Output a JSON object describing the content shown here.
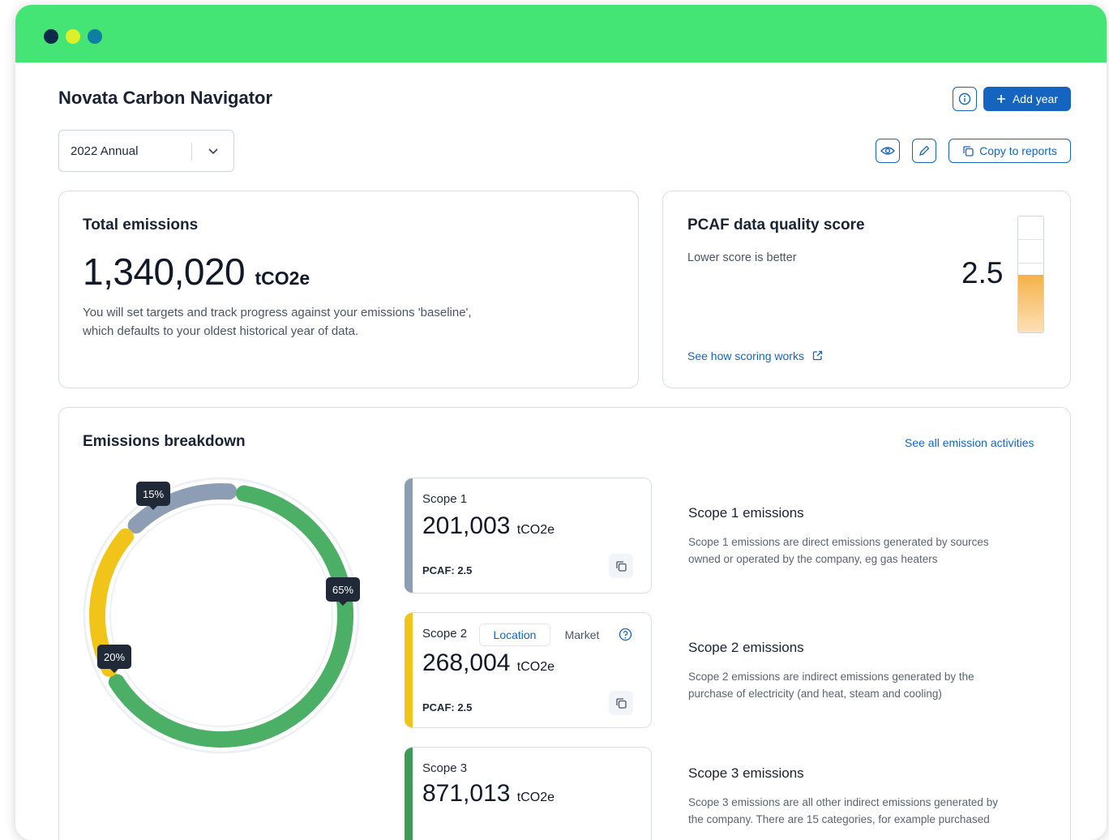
{
  "app": {
    "title": "Novata Carbon Navigator"
  },
  "toolbar": {
    "add_year_label": "Add year",
    "copy_to_reports_label": "Copy to reports",
    "period_select": "2022 Annual"
  },
  "total_emissions": {
    "title": "Total emissions",
    "value": "1,340,020",
    "unit": "tCO2e",
    "description_line1": "You will set targets and track progress against your emissions 'baseline',",
    "description_line2": "which defaults to your oldest historical year of data."
  },
  "pcaf": {
    "title": "PCAF data quality score",
    "subtitle": "Lower score is better",
    "score": "2.5",
    "score_value": 2.5,
    "score_max": 5,
    "link": "See how scoring works"
  },
  "breakdown": {
    "title": "Emissions breakdown",
    "see_all_link": "See all emission activities",
    "donut": [
      {
        "name": "Scope 1",
        "percent": 15,
        "label": "15%",
        "color": "#8d9db3"
      },
      {
        "name": "Scope 2",
        "percent": 20,
        "label": "20%",
        "color": "#f0c419"
      },
      {
        "name": "Scope 3",
        "percent": 65,
        "label": "65%",
        "color": "#4caf66"
      }
    ],
    "scopes": [
      {
        "label": "Scope 1",
        "value": "201,003",
        "unit": "tCO2e",
        "pcaf": "PCAF: 2.5",
        "color": "#8d9db3",
        "desc_title": "Scope 1 emissions",
        "desc_line1": "Scope 1 emissions are direct emissions generated by sources",
        "desc_line2": "owned or operated by the company, eg gas heaters"
      },
      {
        "label": "Scope 2",
        "value": "268,004",
        "unit": "tCO2e",
        "pcaf": "PCAF: 2.5",
        "color": "#f0c419",
        "toggle_location": "Location",
        "toggle_market": "Market",
        "desc_title": "Scope 2 emissions",
        "desc_line1": "Scope 2 emissions are indirect emissions generated by the",
        "desc_line2": "purchase of electricity (and heat, steam and cooling)"
      },
      {
        "label": "Scope 3",
        "value": "871,013",
        "unit": "tCO2e",
        "color": "#3e9a55",
        "desc_title": "Scope 3 emissions",
        "desc_line1": "Scope 3 emissions are all other indirect emissions generated by",
        "desc_line2": "the company. There are 15 categories, for example purchased"
      }
    ]
  }
}
